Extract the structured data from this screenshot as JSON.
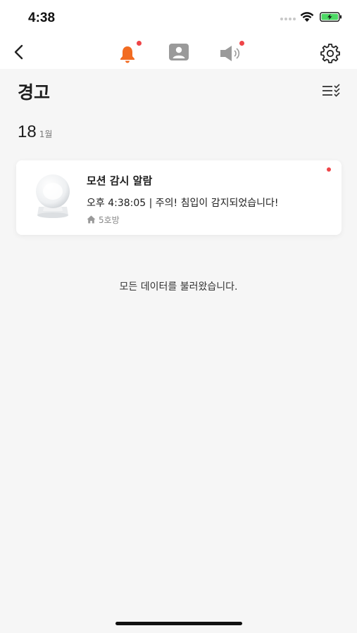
{
  "status_bar": {
    "time": "4:38",
    "icons": [
      "signal-dots-icon",
      "wifi-icon",
      "battery-charging-icon"
    ],
    "battery_color": "#4cd964"
  },
  "nav": {
    "icons": [
      "back-arrow-icon",
      "bell-icon",
      "person-icon",
      "speaker-icon",
      "gear-icon"
    ],
    "active_color": "#f26b21",
    "inactive_color": "#9a9a9a",
    "badge_color": "#ef4548"
  },
  "header": {
    "title": "경고",
    "filter_icon": "list-check-icon"
  },
  "date": {
    "day": "18",
    "month": "1월"
  },
  "alerts": [
    {
      "title": "모션 감시 알람",
      "message": "오후 4:38:05 | 주의! 침입이 감지되었습니다!",
      "room": "5호방",
      "room_icon": "home-icon",
      "unread": true
    }
  ],
  "footer": {
    "loaded_text": "모든 데이터를 불러왔습니다."
  }
}
